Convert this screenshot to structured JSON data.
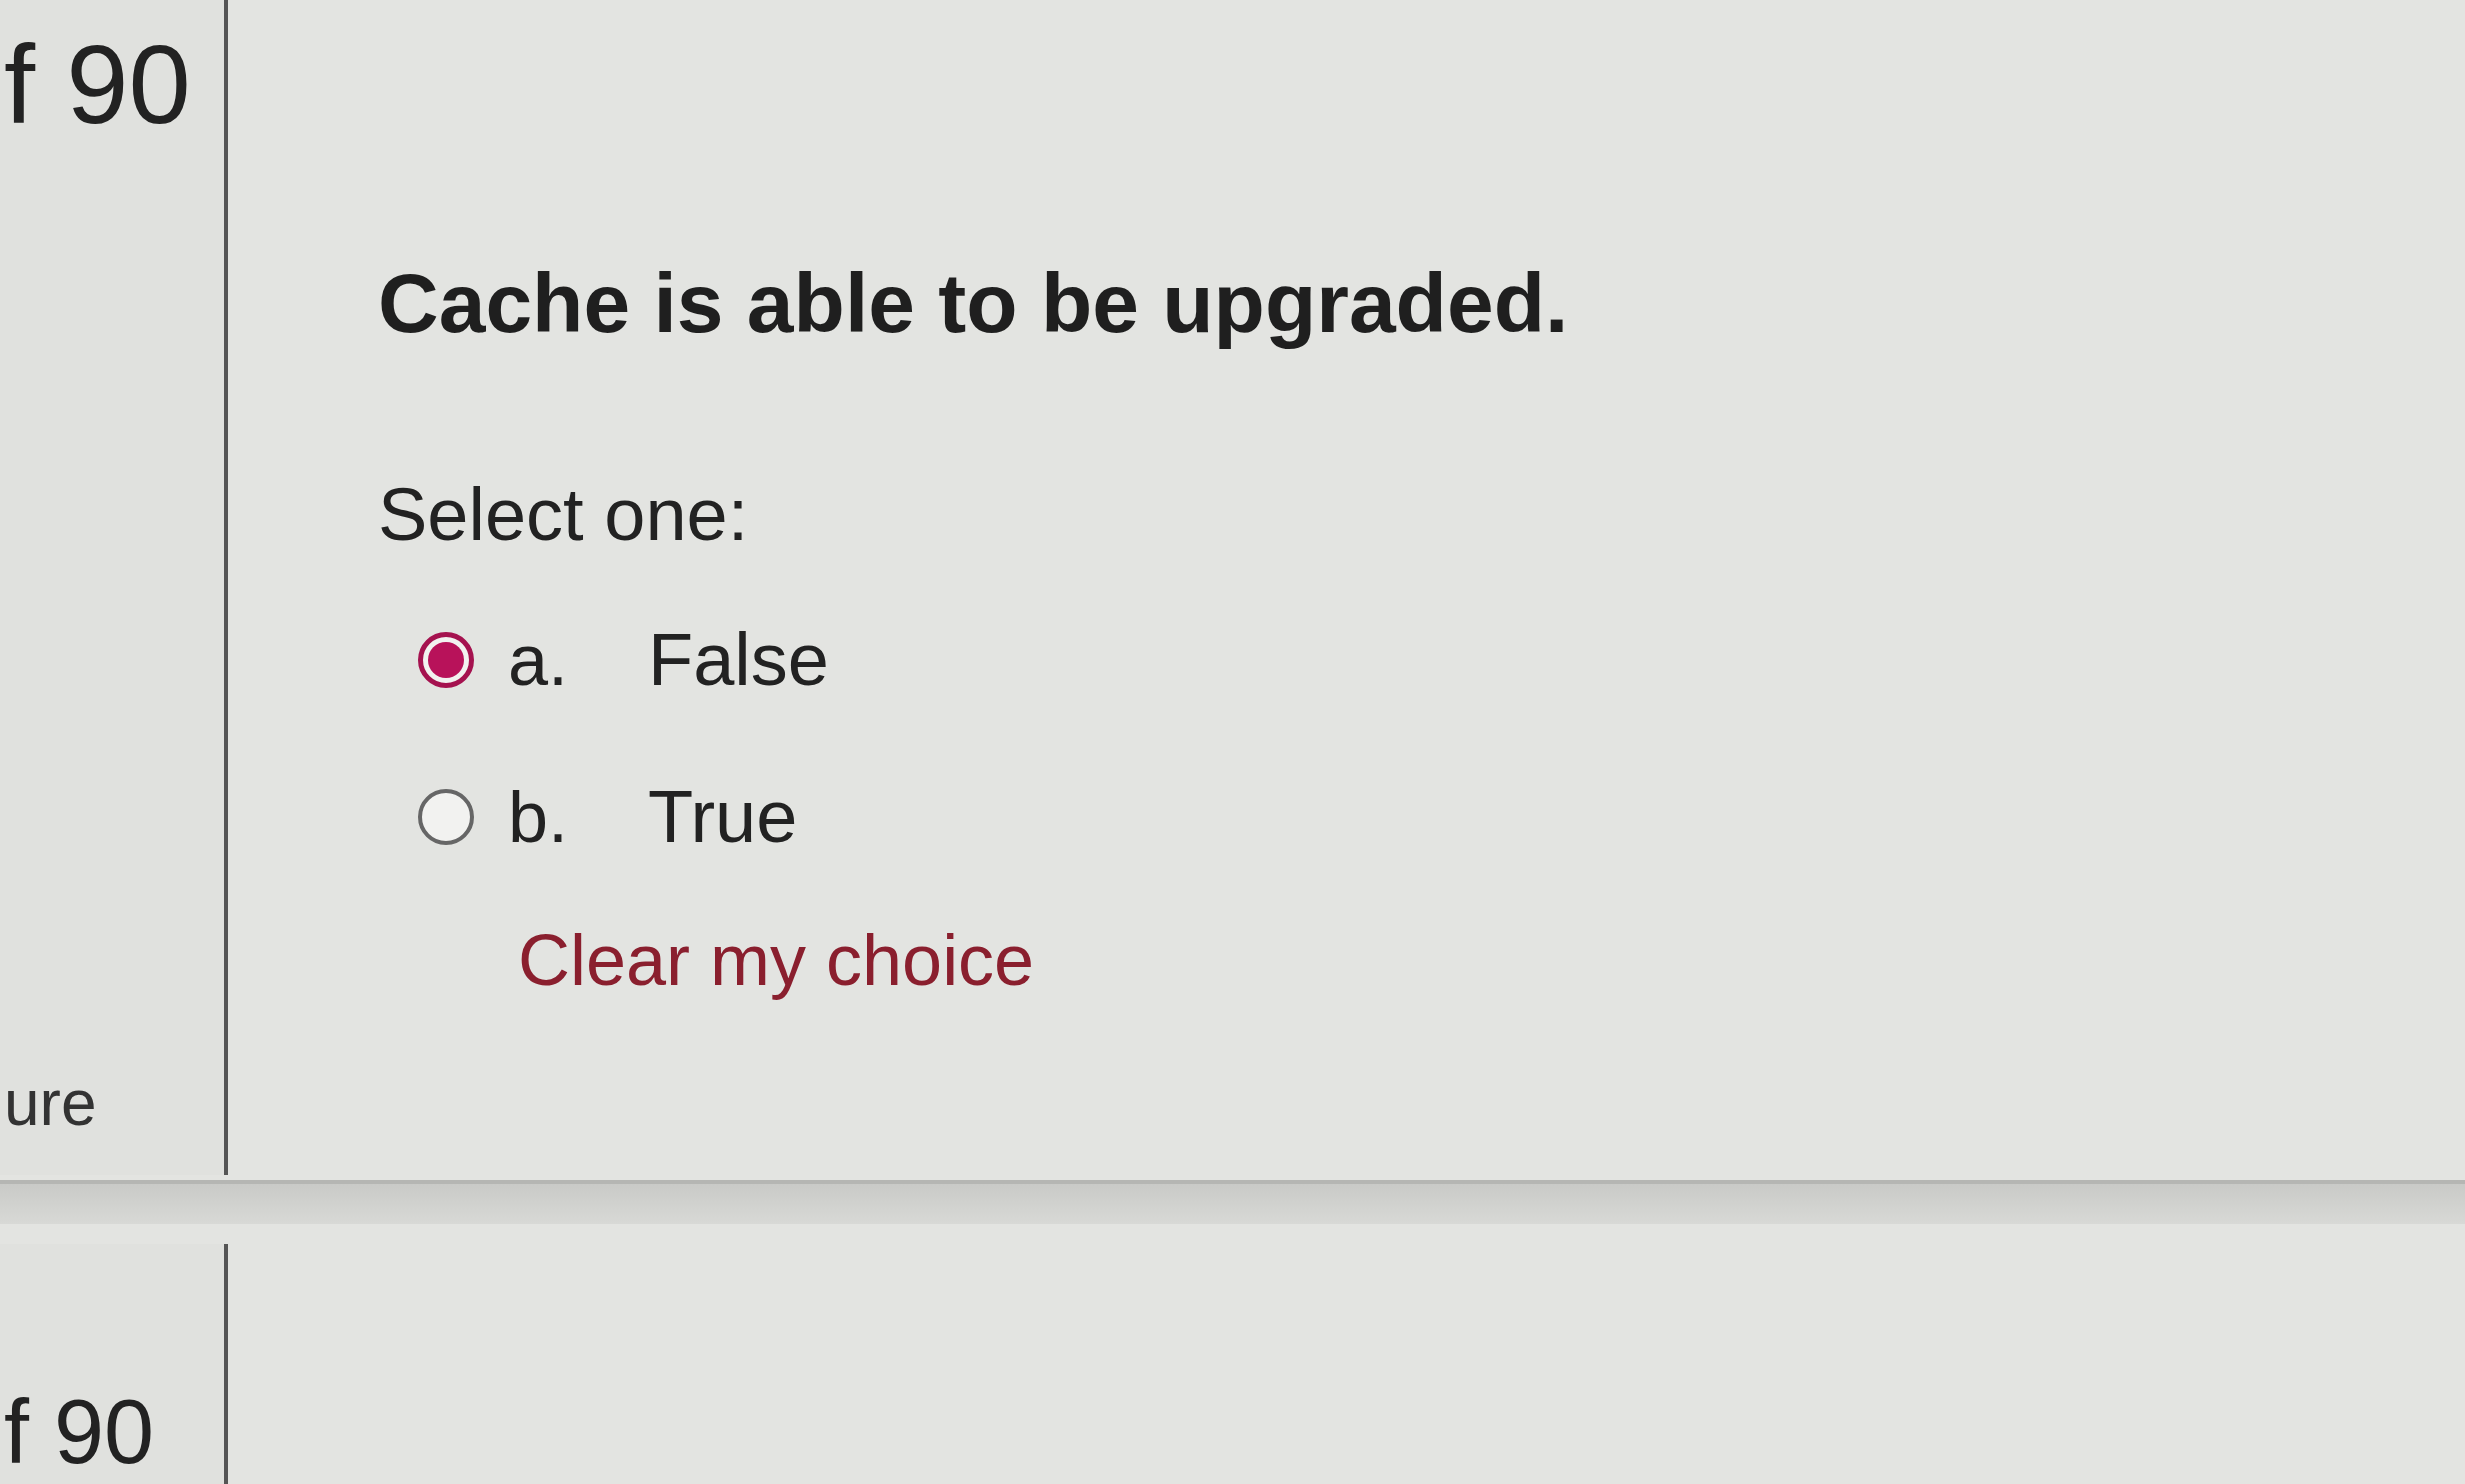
{
  "question_panel": {
    "info": {
      "number": "f 90",
      "status": "ure"
    },
    "question": "Cache is able to be upgraded.",
    "prompt": "Select one:",
    "options": [
      {
        "letter": "a.",
        "label": "False",
        "selected": true
      },
      {
        "letter": "b.",
        "label": "True",
        "selected": false
      }
    ],
    "clear_link": "Clear my choice"
  },
  "next_panel": {
    "info": {
      "number": "f 90"
    }
  }
}
